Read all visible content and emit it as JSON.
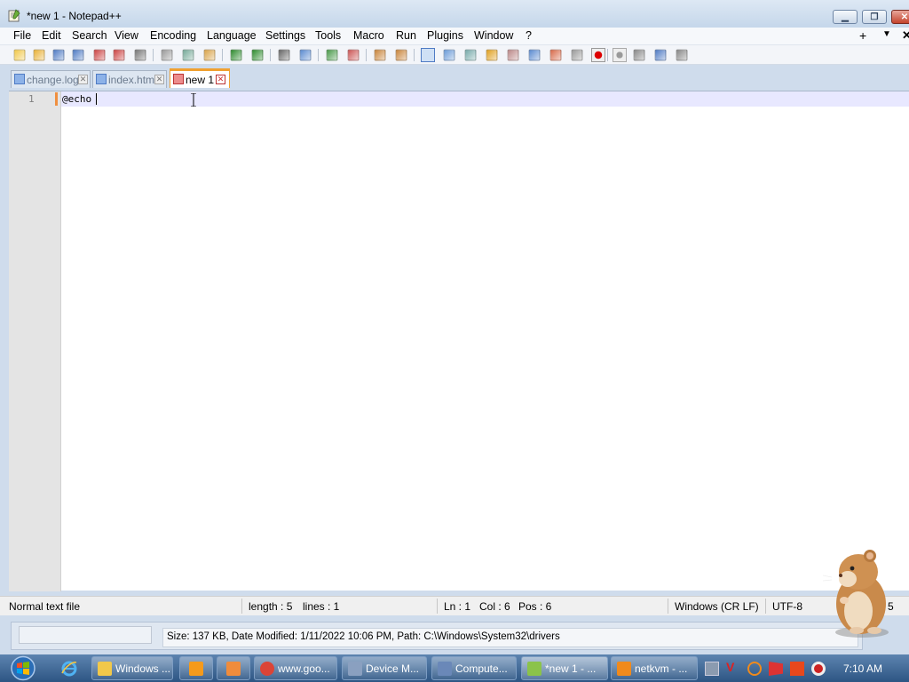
{
  "window": {
    "title": "*new 1 - Notepad++"
  },
  "menu": [
    "File",
    "Edit",
    "Search",
    "View",
    "Encoding",
    "Language",
    "Settings",
    "Tools",
    "Macro",
    "Run",
    "Plugins",
    "Window",
    "?"
  ],
  "menu_right": {
    "plus": "+",
    "down": "▼",
    "close": "✕"
  },
  "toolbar_icons": [
    "new-file-icon",
    "open-file-icon",
    "save-icon",
    "save-all-icon",
    "close-icon",
    "close-all-icon",
    "print-icon",
    "cut-icon",
    "copy-icon",
    "paste-icon",
    "undo-icon",
    "redo-icon",
    "find-icon",
    "replace-icon",
    "zoom-in-icon",
    "zoom-out-icon",
    "sync-vertical-icon",
    "sync-horizontal-icon",
    "word-wrap-icon",
    "show-all-chars-icon",
    "indent-guide-icon",
    "user-defined-lang-icon",
    "doc-map-icon",
    "function-list-icon",
    "folder-as-workspace-icon",
    "monitoring-icon",
    "record-macro-icon",
    "stop-record-icon",
    "play-macro-icon",
    "run-macro-multiple-icon",
    "save-macro-icon"
  ],
  "tabs": [
    {
      "label": "change.log",
      "active": false
    },
    {
      "label": "index.html",
      "active": false
    },
    {
      "label": "new 1",
      "active": true
    }
  ],
  "editor": {
    "line_number": "1",
    "content": "@echo"
  },
  "status": {
    "file_type": "Normal text file",
    "length": "length : 5",
    "lines": "lines : 1",
    "ln": "Ln : 1",
    "col": "Col : 6",
    "pos": "Pos : 6",
    "eol": "Windows (CR LF)",
    "encoding": "UTF-8",
    "ins": "5"
  },
  "explorer_info": "Size: 137 KB, Date Modified: 1/11/2022 10:06 PM, Path: C:\\Windows\\System32\\drivers",
  "taskbar": {
    "buttons": [
      {
        "label": "Windows ...",
        "icon": "folder-icon"
      },
      {
        "label": "",
        "icon": "media-player-icon"
      },
      {
        "label": "",
        "icon": "paint-icon"
      },
      {
        "label": "www.goo...",
        "icon": "chrome-icon"
      },
      {
        "label": "Device M...",
        "icon": "device-manager-icon"
      },
      {
        "label": "Compute...",
        "icon": "computer-management-icon"
      },
      {
        "label": "*new 1 - ...",
        "icon": "notepadpp-icon"
      },
      {
        "label": "netkvm - ...",
        "icon": "search-icon"
      }
    ],
    "clock": "7:10 AM"
  }
}
